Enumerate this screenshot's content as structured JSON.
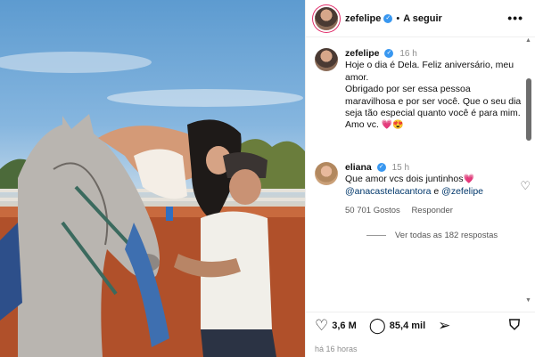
{
  "header": {
    "username": "zefelipe",
    "follow_label": "A seguir",
    "separator": "•",
    "more_label": "•••"
  },
  "caption": {
    "username": "zefelipe",
    "time": "16 h",
    "text": "Hoje o dia é Dela. Feliz aniversário, meu amor.\nObrigado por ser essa pessoa maravilhosa e por ser você. Que o seu dia seja tão especial quanto você é para mim.\nAmo vc.",
    "emojis": "💗😍"
  },
  "comment": {
    "username": "eliana",
    "time": "15 h",
    "text": "Que amor vcs dois juntinhos",
    "emoji": "💗",
    "mention1": "@anacastelacantora",
    "conj": "e",
    "mention2": "@zefelipe",
    "likes": "50 701 Gostos",
    "reply_label": "Responder",
    "view_replies": "Ver todas as 182 respostas"
  },
  "actions": {
    "likes": "3,6 M",
    "comments": "85,4 mil"
  },
  "timestamp": "há 16 horas",
  "icons": {
    "verified": "verified-badge-icon",
    "like": "heart-icon",
    "comment": "comment-icon",
    "share": "paper-plane-icon",
    "save": "bookmark-icon"
  },
  "colors": {
    "verified": "#3897f0",
    "heart_emoji": "#e0245e",
    "mention": "#00376b",
    "story_ring": "#e1306c"
  }
}
